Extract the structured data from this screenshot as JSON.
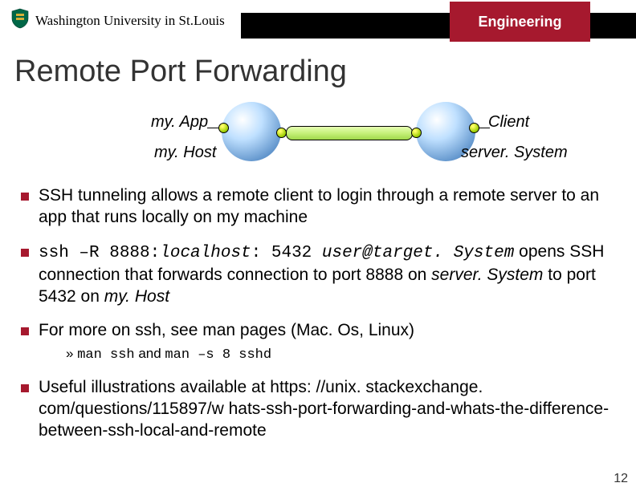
{
  "header": {
    "university": "Washington University in St.Louis",
    "tab": "Engineering"
  },
  "title": "Remote Port Forwarding",
  "diagram": {
    "left_app": "my. App",
    "left_host": "my. Host",
    "right_client": "Client",
    "right_server": "server. System"
  },
  "bullets": {
    "b1": "SSH tunneling allows a remote client to login through a remote server to an app that runs locally on my machine",
    "b2_cmd": "ssh –R 8888:",
    "b2_cmd_it1": "localhost",
    "b2_cmd_mid": ": 5432 ",
    "b2_cmd_it2": "user@target. System",
    "b2_tail1": " opens SSH connection that forwards connection to port 8888 on ",
    "b2_srv": "server. System",
    "b2_tail2": " to port 5432 on ",
    "b2_host": "my. Host",
    "b3": "For more on ssh, see man pages (Mac. Os, Linux)",
    "b3_sub_a": "man ssh",
    "b3_sub_mid": " and ",
    "b3_sub_b": "man –s 8 sshd",
    "b4": "Useful illustrations available at https: //unix. stackexchange. com/questions/115897/w hats-ssh-port-forwarding-and-whats-the-difference-between-ssh-local-and-remote"
  },
  "page_number": "12"
}
